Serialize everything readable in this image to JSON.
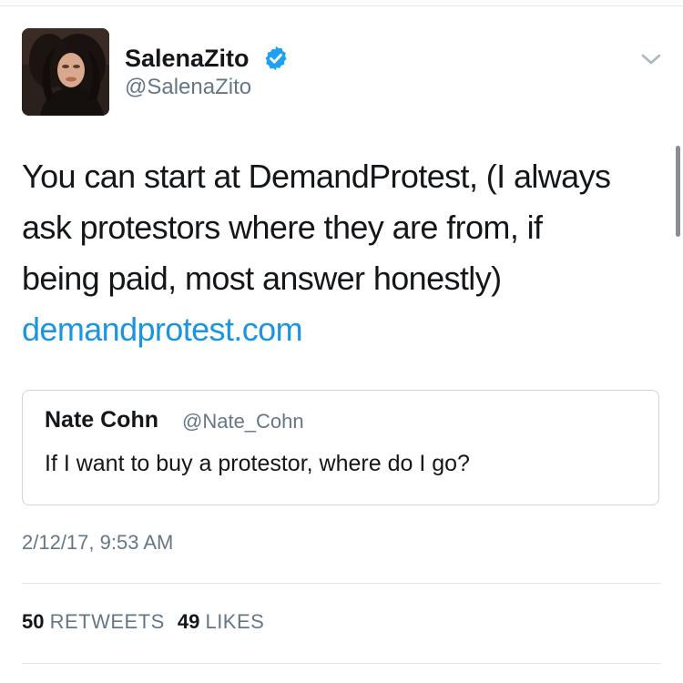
{
  "tweet": {
    "author": {
      "name": "SalenaZito",
      "handle": "@SalenaZito",
      "verified": true,
      "avatar_icon": "user-avatar-photo"
    },
    "text_lines": [
      "You can start at DemandProtest, (I always",
      "ask protestors where they are from, if",
      "being paid, most answer honestly)"
    ],
    "link_text": "demandprotest.com",
    "quoted": {
      "name": "Nate Cohn",
      "handle": "@Nate_Cohn",
      "text": "If I want to buy a protestor, where do I go?"
    },
    "timestamp": "2/12/17, 9:53 AM",
    "stats": {
      "retweets_count": "50",
      "retweets_label": "RETWEETS",
      "likes_count": "49",
      "likes_label": "LIKES"
    },
    "menu_icon": "chevron-down-icon"
  },
  "colors": {
    "link": "#1b95e0",
    "verified": "#1da1f2",
    "secondary_text": "#657786",
    "border": "#ccd6dd"
  }
}
